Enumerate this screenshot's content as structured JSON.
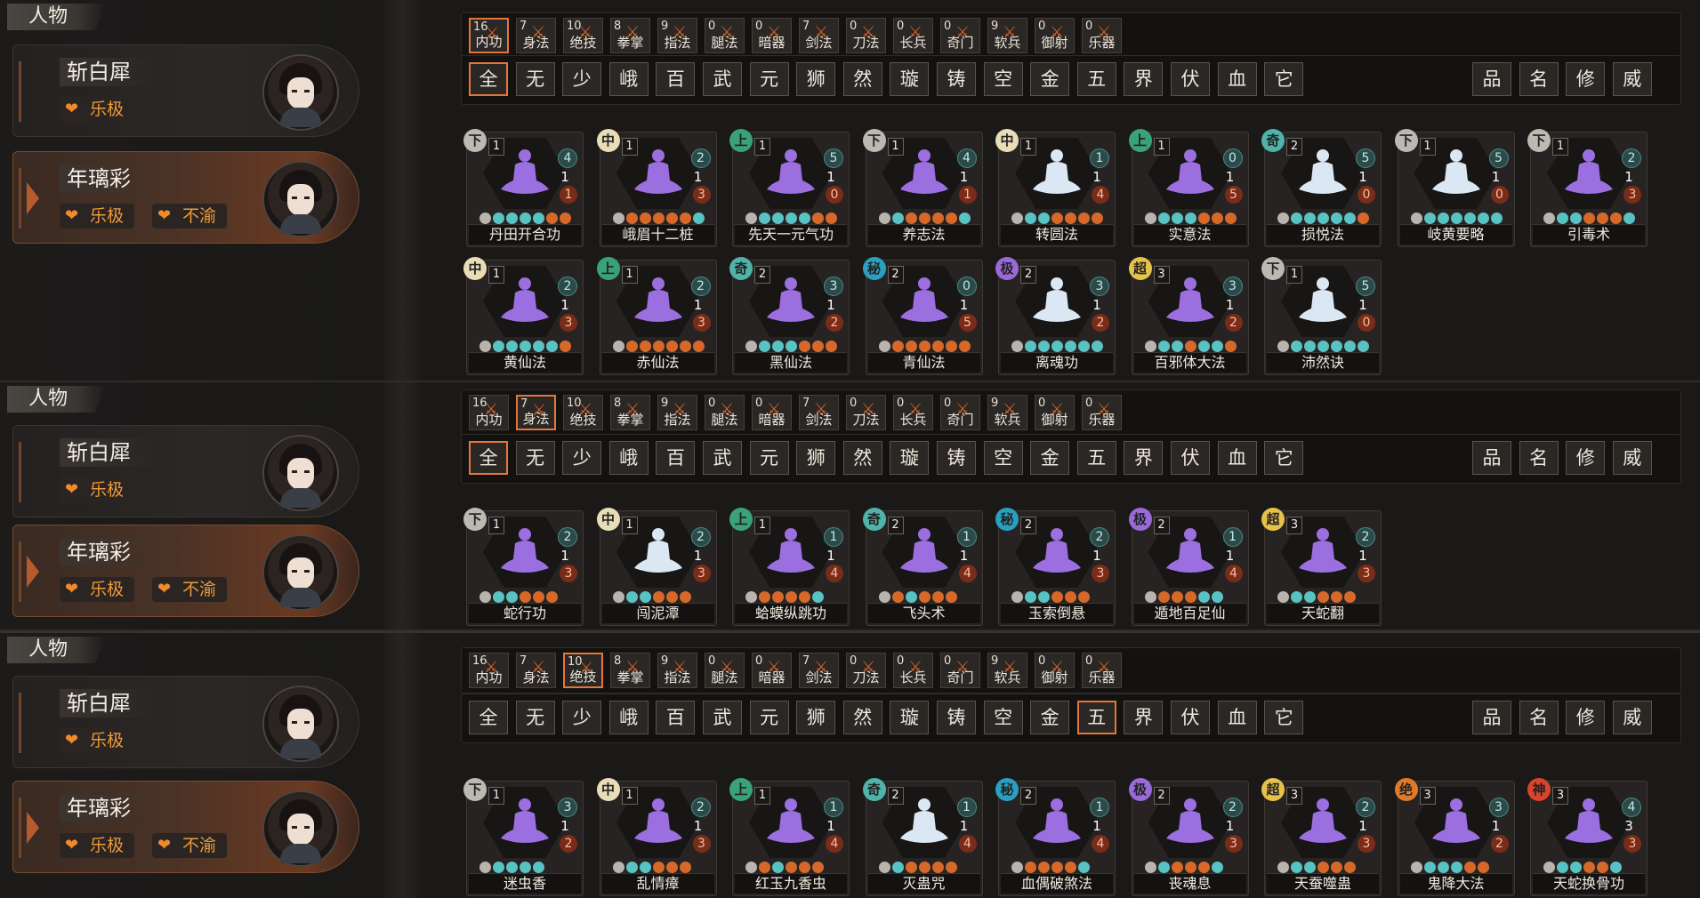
{
  "colors": {
    "accent": "#e3773a",
    "purple": "#9c6fe0",
    "white_fig": "#dbe7f2",
    "teal_dot": "#59c2c2",
    "orange_dot": "#d6692a",
    "grey_dot": "#b9b4ad"
  },
  "panels": [
    {
      "section_title": "人物",
      "characters": [
        {
          "name": "斩白犀",
          "tags": [
            "乐极"
          ],
          "selected": false
        },
        {
          "name": "年璃彩",
          "tags": [
            "乐极",
            "不渝"
          ],
          "selected": true
        }
      ],
      "categories": [
        {
          "count": "16",
          "label": "内功",
          "active": true
        },
        {
          "count": "7",
          "label": "身法"
        },
        {
          "count": "10",
          "label": "绝技"
        },
        {
          "count": "8",
          "label": "拳掌"
        },
        {
          "count": "9",
          "label": "指法"
        },
        {
          "count": "0",
          "label": "腿法"
        },
        {
          "count": "0",
          "label": "暗器"
        },
        {
          "count": "7",
          "label": "剑法"
        },
        {
          "count": "0",
          "label": "刀法"
        },
        {
          "count": "0",
          "label": "长兵"
        },
        {
          "count": "0",
          "label": "奇门"
        },
        {
          "count": "9",
          "label": "软兵"
        },
        {
          "count": "0",
          "label": "御射"
        },
        {
          "count": "0",
          "label": "乐器"
        }
      ],
      "filters": [
        "全",
        "无",
        "少",
        "峨",
        "百",
        "武",
        "元",
        "狮",
        "然",
        "璇",
        "铸",
        "空",
        "金",
        "五",
        "界",
        "伏",
        "血",
        "它"
      ],
      "active_filter": 0,
      "sorts": [
        "品",
        "名",
        "修",
        "威"
      ],
      "skills": [
        {
          "grade": "下",
          "lvl": "1",
          "a": "4",
          "b": "1",
          "c": "1",
          "fig": "purple",
          "name": "丹田开合功",
          "dots": "gttttoo"
        },
        {
          "grade": "中",
          "lvl": "1",
          "a": "2",
          "b": "1",
          "c": "3",
          "fig": "purple",
          "name": "峨眉十二桩",
          "dots": "gooooot"
        },
        {
          "grade": "上",
          "lvl": "1",
          "a": "5",
          "b": "1",
          "c": "0",
          "fig": "purple",
          "name": "先天一元气功",
          "dots": "gttttoo"
        },
        {
          "grade": "下",
          "lvl": "1",
          "a": "4",
          "b": "1",
          "c": "1",
          "fig": "purple",
          "name": "养志法",
          "dots": "gtoooot"
        },
        {
          "grade": "中",
          "lvl": "1",
          "a": "1",
          "b": "1",
          "c": "4",
          "fig": "white",
          "name": "转圆法",
          "dots": "gttoooo"
        },
        {
          "grade": "上",
          "lvl": "1",
          "a": "0",
          "b": "1",
          "c": "5",
          "fig": "purple",
          "name": "实意法",
          "dots": "gtttooo"
        },
        {
          "grade": "奇",
          "lvl": "2",
          "a": "5",
          "b": "1",
          "c": "0",
          "fig": "white",
          "name": "损悦法",
          "dots": "gttttto"
        },
        {
          "grade": "下",
          "lvl": "1",
          "a": "5",
          "b": "1",
          "c": "0",
          "fig": "white",
          "name": "岐黄要略",
          "dots": "gtttttt"
        },
        {
          "grade": "下",
          "lvl": "1",
          "a": "2",
          "b": "1",
          "c": "3",
          "fig": "purple",
          "name": "引毒术",
          "dots": "gttooot"
        },
        {
          "grade": "中",
          "lvl": "1",
          "a": "2",
          "b": "1",
          "c": "3",
          "fig": "purple",
          "name": "黄仙法",
          "dots": "gttttto"
        },
        {
          "grade": "上",
          "lvl": "1",
          "a": "2",
          "b": "1",
          "c": "3",
          "fig": "purple",
          "name": "赤仙法",
          "dots": "goooooo"
        },
        {
          "grade": "奇",
          "lvl": "2",
          "a": "3",
          "b": "1",
          "c": "2",
          "fig": "purple",
          "name": "黑仙法",
          "dots": "gtttooo"
        },
        {
          "grade": "秘",
          "lvl": "2",
          "a": "0",
          "b": "1",
          "c": "5",
          "fig": "purple",
          "name": "青仙法",
          "dots": "goooooo"
        },
        {
          "grade": "极",
          "lvl": "2",
          "a": "3",
          "b": "1",
          "c": "2",
          "fig": "white",
          "name": "离魂功",
          "dots": "gtttttt"
        },
        {
          "grade": "超",
          "lvl": "3",
          "a": "3",
          "b": "1",
          "c": "2",
          "fig": "purple",
          "name": "百邪体大法",
          "dots": "gttotto"
        },
        {
          "grade": "下",
          "lvl": "1",
          "a": "5",
          "b": "1",
          "c": "0",
          "fig": "white",
          "name": "沛然诀",
          "dots": "gtttttt"
        }
      ]
    },
    {
      "section_title": "人物",
      "characters": [
        {
          "name": "斩白犀",
          "tags": [
            "乐极"
          ],
          "selected": false
        },
        {
          "name": "年璃彩",
          "tags": [
            "乐极",
            "不渝"
          ],
          "selected": true
        }
      ],
      "categories": [
        {
          "count": "16",
          "label": "内功"
        },
        {
          "count": "7",
          "label": "身法",
          "active": true
        },
        {
          "count": "10",
          "label": "绝技"
        },
        {
          "count": "8",
          "label": "拳掌"
        },
        {
          "count": "9",
          "label": "指法"
        },
        {
          "count": "0",
          "label": "腿法"
        },
        {
          "count": "0",
          "label": "暗器"
        },
        {
          "count": "7",
          "label": "剑法"
        },
        {
          "count": "0",
          "label": "刀法"
        },
        {
          "count": "0",
          "label": "长兵"
        },
        {
          "count": "0",
          "label": "奇门"
        },
        {
          "count": "9",
          "label": "软兵"
        },
        {
          "count": "0",
          "label": "御射"
        },
        {
          "count": "0",
          "label": "乐器"
        }
      ],
      "filters": [
        "全",
        "无",
        "少",
        "峨",
        "百",
        "武",
        "元",
        "狮",
        "然",
        "璇",
        "铸",
        "空",
        "金",
        "五",
        "界",
        "伏",
        "血",
        "它"
      ],
      "active_filter": 0,
      "sorts": [
        "品",
        "名",
        "修",
        "威"
      ],
      "skills": [
        {
          "grade": "下",
          "lvl": "1",
          "a": "2",
          "b": "1",
          "c": "3",
          "fig": "purple",
          "name": "蛇行功",
          "dots": "gttooo"
        },
        {
          "grade": "中",
          "lvl": "1",
          "a": "2",
          "b": "1",
          "c": "3",
          "fig": "white",
          "name": "闯泥潭",
          "dots": "gttooo"
        },
        {
          "grade": "上",
          "lvl": "1",
          "a": "1",
          "b": "1",
          "c": "4",
          "fig": "purple",
          "name": "蛤蟆纵跳功",
          "dots": "goooot"
        },
        {
          "grade": "奇",
          "lvl": "2",
          "a": "1",
          "b": "1",
          "c": "4",
          "fig": "purple",
          "name": "飞头术",
          "dots": "gotooo"
        },
        {
          "grade": "秘",
          "lvl": "2",
          "a": "2",
          "b": "1",
          "c": "3",
          "fig": "purple",
          "name": "玉索倒悬",
          "dots": "gttooo"
        },
        {
          "grade": "极",
          "lvl": "2",
          "a": "1",
          "b": "1",
          "c": "4",
          "fig": "purple",
          "name": "遁地百足仙",
          "dots": "gooott"
        },
        {
          "grade": "超",
          "lvl": "3",
          "a": "2",
          "b": "1",
          "c": "3",
          "fig": "purple",
          "name": "天蛇翻",
          "dots": "gttooo"
        }
      ]
    },
    {
      "section_title": "人物",
      "characters": [
        {
          "name": "斩白犀",
          "tags": [
            "乐极"
          ],
          "selected": false
        },
        {
          "name": "年璃彩",
          "tags": [
            "乐极",
            "不渝"
          ],
          "selected": true
        }
      ],
      "categories": [
        {
          "count": "16",
          "label": "内功"
        },
        {
          "count": "7",
          "label": "身法"
        },
        {
          "count": "10",
          "label": "绝技",
          "active": true
        },
        {
          "count": "8",
          "label": "拳掌"
        },
        {
          "count": "9",
          "label": "指法"
        },
        {
          "count": "0",
          "label": "腿法"
        },
        {
          "count": "0",
          "label": "暗器"
        },
        {
          "count": "7",
          "label": "剑法"
        },
        {
          "count": "0",
          "label": "刀法"
        },
        {
          "count": "0",
          "label": "长兵"
        },
        {
          "count": "0",
          "label": "奇门"
        },
        {
          "count": "9",
          "label": "软兵"
        },
        {
          "count": "0",
          "label": "御射"
        },
        {
          "count": "0",
          "label": "乐器"
        }
      ],
      "filters": [
        "全",
        "无",
        "少",
        "峨",
        "百",
        "武",
        "元",
        "狮",
        "然",
        "璇",
        "铸",
        "空",
        "金",
        "五",
        "界",
        "伏",
        "血",
        "它"
      ],
      "active_filter": 13,
      "sorts": [
        "品",
        "名",
        "修",
        "威"
      ],
      "skills": [
        {
          "grade": "下",
          "lvl": "1",
          "a": "3",
          "b": "1",
          "c": "2",
          "fig": "purple",
          "name": "迷虫香",
          "dots": "gtttt"
        },
        {
          "grade": "中",
          "lvl": "1",
          "a": "2",
          "b": "1",
          "c": "3",
          "fig": "purple",
          "name": "乱情瘴",
          "dots": "gttooo"
        },
        {
          "grade": "上",
          "lvl": "1",
          "a": "1",
          "b": "1",
          "c": "4",
          "fig": "purple",
          "name": "红玉九香虫",
          "dots": "gotooo"
        },
        {
          "grade": "奇",
          "lvl": "2",
          "a": "1",
          "b": "1",
          "c": "4",
          "fig": "white",
          "name": "灭蛊咒",
          "dots": "gtoooo"
        },
        {
          "grade": "秘",
          "lvl": "2",
          "a": "1",
          "b": "1",
          "c": "4",
          "fig": "purple",
          "name": "血偶破煞法",
          "dots": "goooot"
        },
        {
          "grade": "极",
          "lvl": "2",
          "a": "2",
          "b": "1",
          "c": "3",
          "fig": "purple",
          "name": "丧魂息",
          "dots": "gtooot"
        },
        {
          "grade": "超",
          "lvl": "3",
          "a": "2",
          "b": "1",
          "c": "3",
          "fig": "purple",
          "name": "天蚕噬蛊",
          "dots": "gttooo"
        },
        {
          "grade": "绝",
          "lvl": "3",
          "a": "3",
          "b": "1",
          "c": "2",
          "fig": "purple",
          "name": "鬼降大法",
          "dots": "gtttoo"
        },
        {
          "grade": "神",
          "lvl": "3",
          "a": "4",
          "b": "3",
          "c": "3",
          "fig": "purple",
          "name": "天蛇换骨功",
          "dots": "gttoot"
        }
      ]
    }
  ]
}
